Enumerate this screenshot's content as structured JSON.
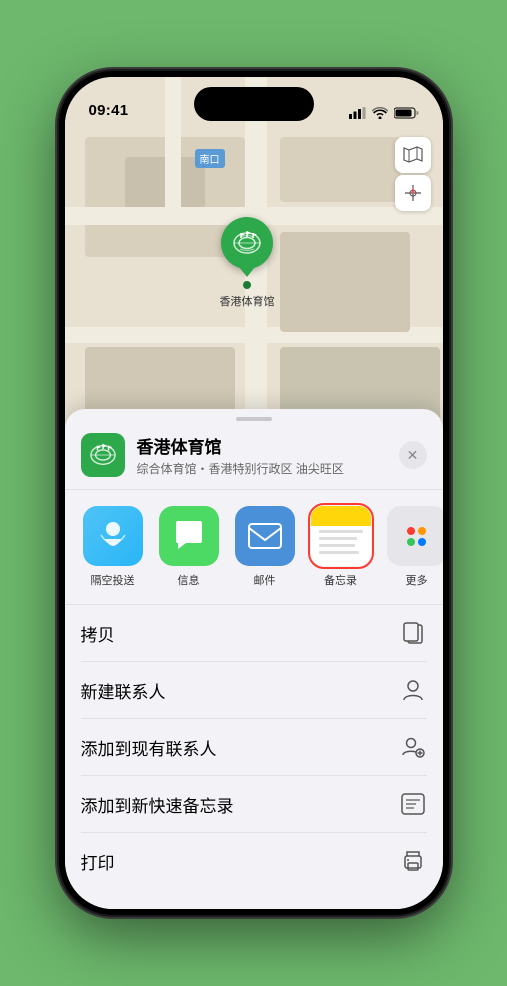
{
  "status_bar": {
    "time": "09:41",
    "location_icon": "◀",
    "signal_bars": "▌▌▌",
    "wifi": "wifi",
    "battery": "battery"
  },
  "map": {
    "label": "南口",
    "map_type_icon": "🗺",
    "location_icon": "➤"
  },
  "pin": {
    "label": "香港体育馆"
  },
  "sheet": {
    "venue_name": "香港体育馆",
    "venue_desc": "综合体育馆・香港特别行政区 油尖旺区",
    "close_label": "✕"
  },
  "share_items": [
    {
      "id": "airdrop",
      "label": "隔空投送"
    },
    {
      "id": "messages",
      "label": "信息"
    },
    {
      "id": "mail",
      "label": "邮件"
    },
    {
      "id": "notes",
      "label": "备忘录"
    },
    {
      "id": "more",
      "label": "更多"
    }
  ],
  "actions": [
    {
      "id": "copy",
      "label": "拷贝",
      "icon": "copy"
    },
    {
      "id": "new-contact",
      "label": "新建联系人",
      "icon": "person"
    },
    {
      "id": "add-existing",
      "label": "添加到现有联系人",
      "icon": "person-add"
    },
    {
      "id": "add-notes",
      "label": "添加到新快速备忘录",
      "icon": "notes"
    },
    {
      "id": "print",
      "label": "打印",
      "icon": "print"
    }
  ]
}
